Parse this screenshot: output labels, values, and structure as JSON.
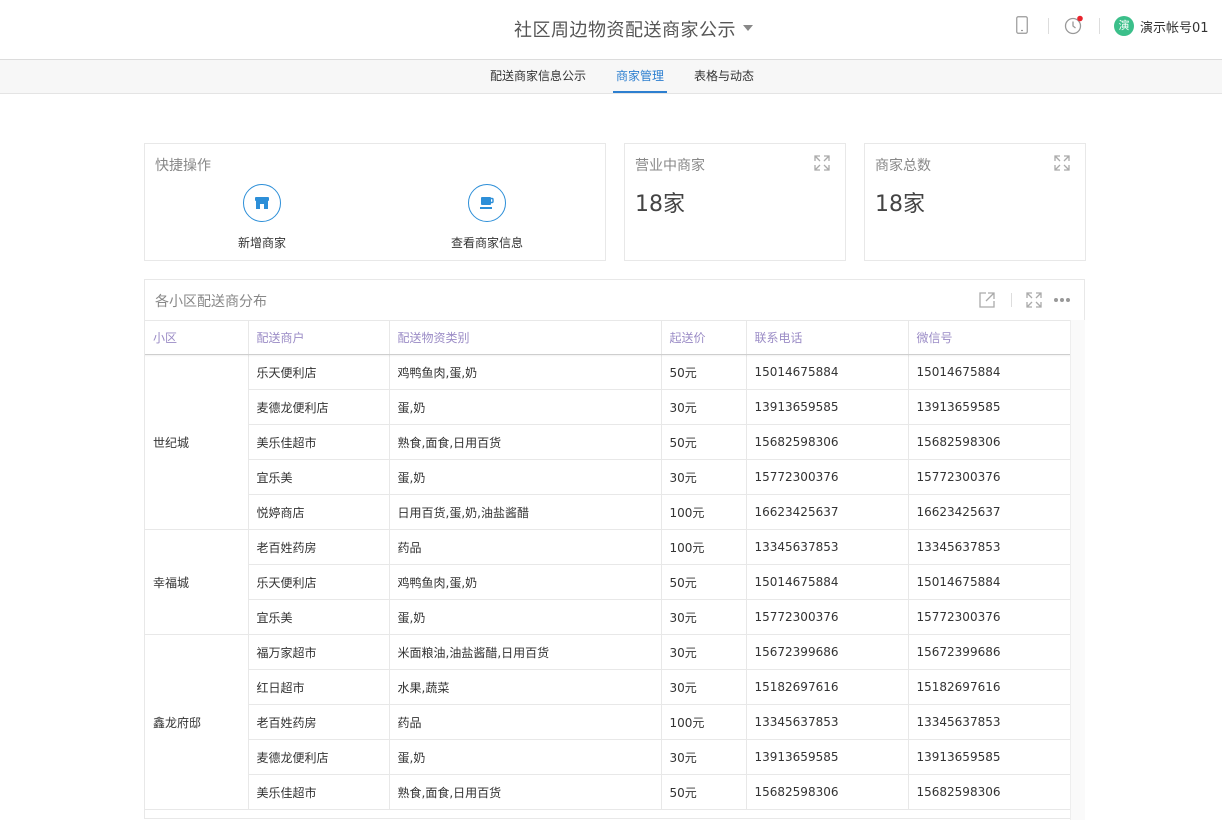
{
  "header": {
    "title": "社区周边物资配送商家公示",
    "account_avatar": "演",
    "account_name": "演示帐号01",
    "icons": [
      "phone-icon",
      "clock-icon"
    ],
    "notification_color": "#e8232c"
  },
  "tabs": [
    {
      "label": "配送商家信息公示",
      "active": false
    },
    {
      "label": "商家管理",
      "active": true
    },
    {
      "label": "表格与动态",
      "active": false
    }
  ],
  "quick_ops": {
    "title": "快捷操作",
    "buttons": [
      {
        "label": "新增商家",
        "icon": "store-icon"
      },
      {
        "label": "查看商家信息",
        "icon": "cup-icon"
      }
    ]
  },
  "open_merchants": {
    "title": "营业中商家",
    "value": "18家"
  },
  "total_merchants": {
    "title": "商家总数",
    "value": "18家"
  },
  "distribution": {
    "title": "各小区配送商分布",
    "columns": [
      "小区",
      "配送商户",
      "配送物资类别",
      "起送价",
      "联系电话",
      "微信号"
    ],
    "groups": [
      {
        "community": "世纪城",
        "rows": [
          [
            "乐天便利店",
            "鸡鸭鱼肉,蛋,奶",
            "50元",
            "15014675884",
            "15014675884"
          ],
          [
            "麦德龙便利店",
            "蛋,奶",
            "30元",
            "13913659585",
            "13913659585"
          ],
          [
            "美乐佳超市",
            "熟食,面食,日用百货",
            "50元",
            "15682598306",
            "15682598306"
          ],
          [
            "宜乐美",
            "蛋,奶",
            "30元",
            "15772300376",
            "15772300376"
          ],
          [
            "悦婷商店",
            "日用百货,蛋,奶,油盐酱醋",
            "100元",
            "16623425637",
            "16623425637"
          ]
        ]
      },
      {
        "community": "幸福城",
        "rows": [
          [
            "老百姓药房",
            "药品",
            "100元",
            "13345637853",
            "13345637853"
          ],
          [
            "乐天便利店",
            "鸡鸭鱼肉,蛋,奶",
            "50元",
            "15014675884",
            "15014675884"
          ],
          [
            "宜乐美",
            "蛋,奶",
            "30元",
            "15772300376",
            "15772300376"
          ]
        ]
      },
      {
        "community": "鑫龙府邸",
        "rows": [
          [
            "福万家超市",
            "米面粮油,油盐酱醋,日用百货",
            "30元",
            "15672399686",
            "15672399686"
          ],
          [
            "红日超市",
            "水果,蔬菜",
            "30元",
            "15182697616",
            "15182697616"
          ],
          [
            "老百姓药房",
            "药品",
            "100元",
            "13345637853",
            "13345637853"
          ],
          [
            "麦德龙便利店",
            "蛋,奶",
            "30元",
            "13913659585",
            "13913659585"
          ],
          [
            "美乐佳超市",
            "熟食,面食,日用百货",
            "50元",
            "15682598306",
            "15682598306"
          ]
        ]
      }
    ]
  }
}
